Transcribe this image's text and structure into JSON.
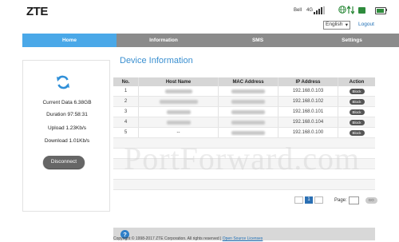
{
  "header": {
    "logo": "ZTE",
    "carrier": "Bell",
    "network_mode": "4G",
    "signal_icon": "signal-bars-icon",
    "globe_icon": "globe-icon",
    "traffic_icon": "up-down-arrows-icon"
  },
  "language": {
    "selected": "English",
    "logout": "Logout"
  },
  "nav": {
    "tabs": [
      "Home",
      "Information",
      "SMS",
      "Settings"
    ]
  },
  "side": {
    "current_data": "Current Data 6.38GB",
    "duration": "Duration 97:58:31",
    "upload": "Upload 1.23Kb/s",
    "download": "Download 1.01Kb/s",
    "disconnect": "Disconnect"
  },
  "main": {
    "title": "Device Information",
    "columns": [
      "No.",
      "Host Name",
      "MAC Address",
      "IP Address",
      "Action"
    ],
    "rows": [
      {
        "no": "1",
        "host": "",
        "mac": "",
        "ip": "192.168.0.103",
        "action": "Block"
      },
      {
        "no": "2",
        "host": "",
        "mac": "",
        "ip": "192.168.0.102",
        "action": "Block"
      },
      {
        "no": "3",
        "host": "",
        "mac": "",
        "ip": "192.168.0.101",
        "action": "Block"
      },
      {
        "no": "4",
        "host": "",
        "mac": "",
        "ip": "192.168.0.104",
        "action": "Block"
      },
      {
        "no": "5",
        "host": "--",
        "mac": "",
        "ip": "192.168.0.100",
        "action": "Block"
      }
    ]
  },
  "pagination": {
    "current": "1",
    "page_label": "Page:",
    "go": "GO"
  },
  "watermark": "PortForward.com",
  "footer": {
    "copyright": "Copyright © 1998-2017 ZTE Corporation. All rights reserved  |",
    "link": "Open Source Licenses"
  }
}
